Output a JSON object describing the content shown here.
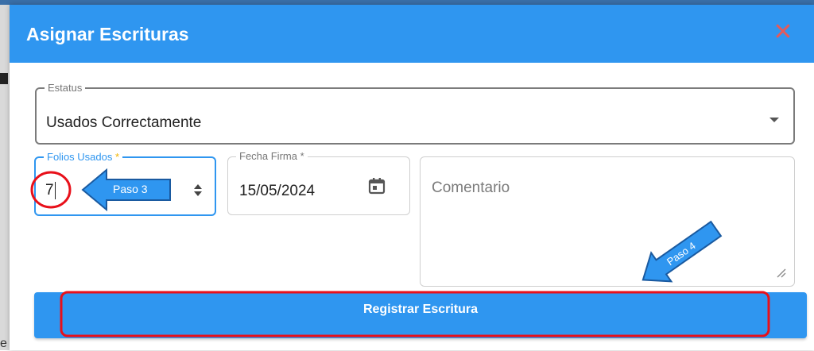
{
  "dialog": {
    "title": "Asignar Escrituras",
    "close_icon": "close-icon"
  },
  "form": {
    "status": {
      "label": "Estatus",
      "value": "Usados Correctamente"
    },
    "folios": {
      "label": "Folios Usados",
      "required_mark": "*",
      "value": "7"
    },
    "fecha": {
      "label": "Fecha Firma *",
      "value": "15/05/2024"
    },
    "comentario": {
      "placeholder": "Comentario"
    },
    "submit_label": "Registrar Escritura"
  },
  "annotations": {
    "paso3": "Paso 3",
    "paso4": "Paso 4"
  },
  "colors": {
    "primary": "#2f96f0",
    "annotation_red": "#e8101a",
    "close_red": "#e55a5a",
    "required_yellow": "#f0b400"
  },
  "background": {
    "partial_glyph": "e"
  }
}
